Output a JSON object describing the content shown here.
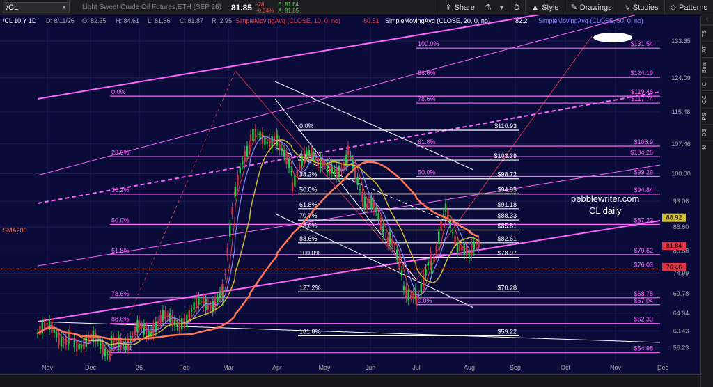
{
  "toolbar": {
    "symbol": "/CL",
    "description": "Light Sweet Crude Oil Futures,ETH (SEP 26)",
    "last_price": "81.85",
    "change": "-28",
    "change_pct": "-0.34%",
    "bid": "B: 81.84",
    "ask": "A: 81.85",
    "share_label": "Share",
    "d_label": "D",
    "style_label": "Style",
    "drawings_label": "Drawings",
    "studies_label": "Studies",
    "patterns_label": "Patterns"
  },
  "header": {
    "instrument": "/CL 10 Y 1D",
    "date": "D: 8/11/26",
    "open": "O: 82.35",
    "high": "H: 84.61",
    "low": "L: 81.66",
    "close": "C: 81.87",
    "range": "R: 2.95",
    "sma10_label": "SimpleMovingAvg (CLOSE, 10, 0, no)",
    "sma10_value": "80.51",
    "sma20_label": "SimpleMovingAvg (CLOSE, 20, 0, no)",
    "sma20_value": "82.2",
    "sma50_label": "SimpleMovingAvg (CLOSE, 50, 0, no)"
  },
  "annotations": {
    "watermark_1": "pebblewriter.com",
    "watermark_2": "CL daily",
    "sma200_label": "SMA200"
  },
  "sidebar": [
    "TS",
    "AT",
    "Btns",
    "C",
    "OC",
    "PS",
    "DB",
    "N"
  ],
  "colors": {
    "background": "#0b0b3a",
    "fib_pink": "#ff66ff",
    "fib_white": "#ffffff",
    "price_red": "#cc3344",
    "sma10": "#dd4444",
    "sma20": "#8888ff",
    "sma50": "#ccbb33",
    "sma200": "#ff7755"
  },
  "chart_data": {
    "type": "candlestick",
    "x_ticks": [
      "Nov",
      "Dec",
      "26",
      "Feb",
      "Mar",
      "Apr",
      "May",
      "Jun",
      "Jul",
      "Aug",
      "Sep",
      "Oct",
      "Nov",
      "Dec"
    ],
    "y_ticks": [
      133.35,
      124.09,
      115.48,
      107.46,
      100,
      93.06,
      86.6,
      80.58,
      74.99,
      69.78,
      64.94,
      60.43,
      56.23
    ],
    "ylim": [
      53,
      137
    ],
    "price_tags": [
      {
        "value": 88.92,
        "label": "88.92",
        "color": "#ccbb33"
      },
      {
        "value": 81.84,
        "label": "81.84",
        "color": "#dd3344"
      },
      {
        "value": 76.46,
        "label": "76.46",
        "color": "#dd3344"
      }
    ],
    "fib_large": [
      {
        "pct": "0.0%",
        "value": 119.48,
        "label": "$119.48"
      },
      {
        "pct": "23.6%",
        "value": 104.26,
        "label": "$104.26"
      },
      {
        "pct": "38.2%",
        "value": 94.84,
        "label": "$94.84"
      },
      {
        "pct": "50.0%",
        "value": 87.23,
        "label": "$87.23"
      },
      {
        "pct": "61.8%",
        "value": 79.62,
        "label": "$79.62"
      },
      {
        "pct": "78.6%",
        "value": 68.78,
        "label": "$68.78"
      },
      {
        "pct": "88.6%",
        "value": 62.33,
        "label": "$62.33"
      },
      {
        "pct": "100.0%",
        "value": 54.98,
        "label": "$54.98"
      }
    ],
    "fib_upper": [
      {
        "pct": "100.0%",
        "value": 131.54,
        "label": "$131.54"
      },
      {
        "pct": "88.6%",
        "value": 124.19,
        "label": "$124.19"
      },
      {
        "pct": "78.6%",
        "value": 117.74,
        "label": "$117.74"
      },
      {
        "pct": "61.8%",
        "value": 106.9,
        "label": "$106.9"
      },
      {
        "pct": "50.0%",
        "value": 99.29,
        "label": "$99.29"
      },
      {
        "pct": "0.0%",
        "value": 67.04,
        "label": "$67.04"
      }
    ],
    "fib_white": [
      {
        "pct": "0.0%",
        "value": 110.93,
        "label": "$110.93"
      },
      {
        "pct": "23.6%",
        "value": 103.39,
        "label": "$103.39"
      },
      {
        "pct": "38.2%",
        "value": 98.72,
        "label": "$98.72"
      },
      {
        "pct": "50.0%",
        "value": 94.95,
        "label": "$94.95"
      },
      {
        "pct": "61.8%",
        "value": 91.18,
        "label": "$91.18"
      },
      {
        "pct": "70.7%",
        "value": 88.33,
        "label": "$88.33"
      },
      {
        "pct": "78.6%",
        "value": 85.81,
        "label": "$85.81"
      },
      {
        "pct": "88.6%",
        "value": 82.61,
        "label": "$82.61"
      },
      {
        "pct": "100.0%",
        "value": 78.97,
        "label": "$78.97"
      },
      {
        "pct": "127.2%",
        "value": 70.28,
        "label": "$70.28"
      },
      {
        "pct": "161.8%",
        "value": 59.22,
        "label": "$59.22"
      }
    ],
    "sma200_level": 76.03,
    "sma200_level_label": "$76.03"
  }
}
